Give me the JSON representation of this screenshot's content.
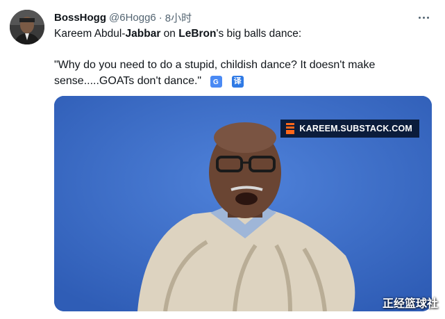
{
  "tweet": {
    "author_name": "BossHogg",
    "handle": "@6Hogg6",
    "separator": "·",
    "time": "8小时",
    "text_part1": "Kareem Abdul-",
    "text_bold1": "Jabbar",
    "text_part2": " on ",
    "text_bold2": "LeBron",
    "text_part3": "'s big balls dance:",
    "quote": "\"Why do you need to do a stupid, childish dance? It doesn't make sense.....GOATs don't dance.\"",
    "translate_icon_1": "google-translate-icon",
    "translate_icon_2": "译"
  },
  "video": {
    "brand_text": "KAREEM.SUBSTACK.COM",
    "brand_icon": "substack-icon"
  },
  "watermark": "正经篮球社",
  "colors": {
    "video_background": "#3d6fc9",
    "brand_background": "#0b1c3b",
    "brand_accent": "#ff6719",
    "secondary_text": "#536471"
  }
}
